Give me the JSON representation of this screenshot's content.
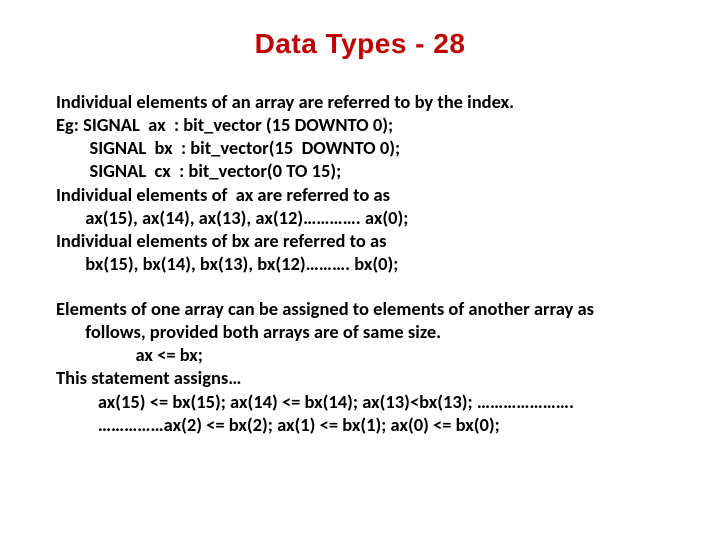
{
  "title": "Data Types - 28",
  "lines": {
    "l1": "Individual elements of an array are referred to by the index.",
    "l2": "Eg: SIGNAL  ax  : bit_vector (15 DOWNTO 0);",
    "l3": "        SIGNAL  bx  : bit_vector(15  DOWNTO 0);",
    "l4": "        SIGNAL  cx  : bit_vector(0 TO 15);",
    "l5": "Individual elements of  ax are referred to as",
    "l6": "       ax(15), ax(14), ax(13), ax(12)…………. ax(0);",
    "l7": "Individual elements of bx are referred to as",
    "l8": "       bx(15), bx(14), bx(13), bx(12)………. bx(0);",
    "l9": "Elements of one array can be assigned to elements of another array as",
    "l10": "       follows, provided both arrays are of same size.",
    "l11": "                   ax <= bx;",
    "l12": "This statement assigns…",
    "l13": "          ax(15) <= bx(15); ax(14) <= bx(14); ax(13)<bx(13); ………………….",
    "l14": "          ……………ax(2) <= bx(2); ax(1) <= bx(1); ax(0) <= bx(0);"
  }
}
